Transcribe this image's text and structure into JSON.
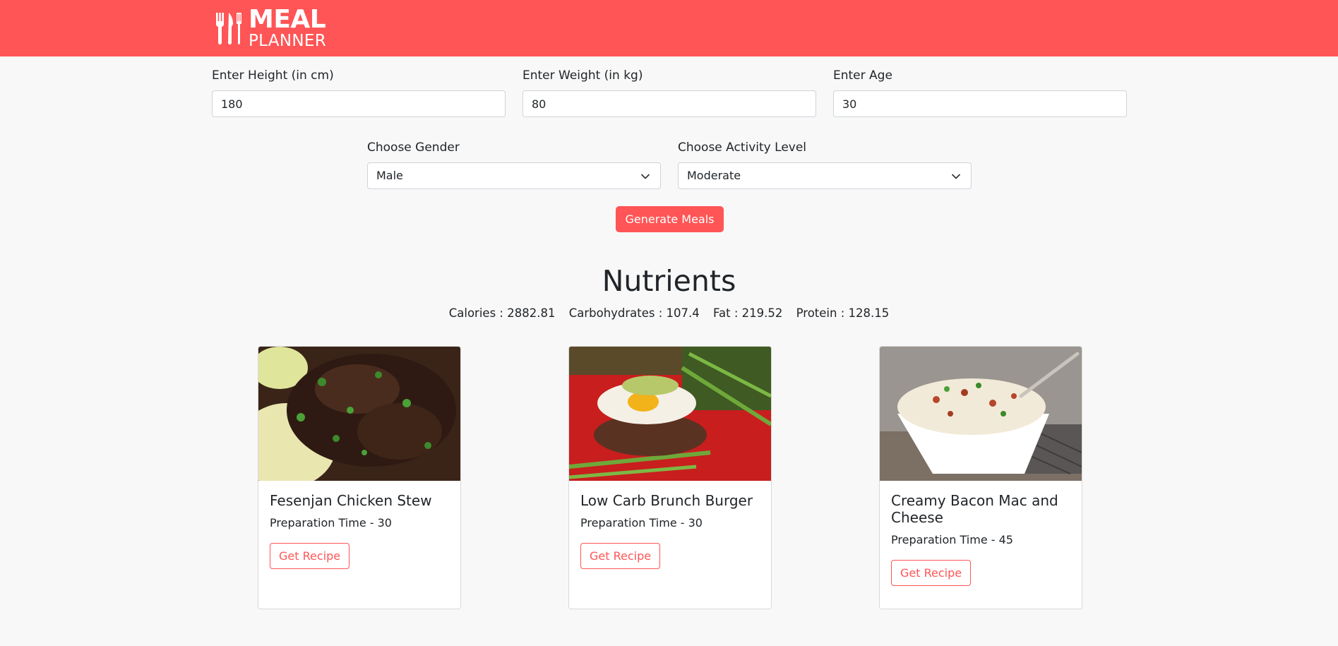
{
  "header": {
    "logo_line1": "MEAL",
    "logo_line2": "PLANNER",
    "brand_color": "#ff5556",
    "icon": "utensils-icon"
  },
  "form": {
    "height": {
      "label": "Enter Height (in cm)",
      "value": "180"
    },
    "weight": {
      "label": "Enter Weight (in kg)",
      "value": "80"
    },
    "age": {
      "label": "Enter Age",
      "value": "30"
    },
    "gender": {
      "label": "Choose Gender",
      "selected": "Male"
    },
    "activity": {
      "label": "Choose Activity Level",
      "selected": "Moderate"
    },
    "generate_label": "Generate Meals"
  },
  "nutrients": {
    "title": "Nutrients",
    "calories": "Calories : 2882.81",
    "carbohydrates": "Carbohydrates : 107.4",
    "fat": "Fat : 219.52",
    "protein": "Protein : 128.15"
  },
  "meals": [
    {
      "title": "Fesenjan Chicken Stew",
      "prep": "Preparation Time - 30",
      "button": "Get Recipe"
    },
    {
      "title": "Low Carb Brunch Burger",
      "prep": "Preparation Time - 30",
      "button": "Get Recipe"
    },
    {
      "title": "Creamy Bacon Mac and Cheese",
      "prep": "Preparation Time - 45",
      "button": "Get Recipe"
    }
  ]
}
